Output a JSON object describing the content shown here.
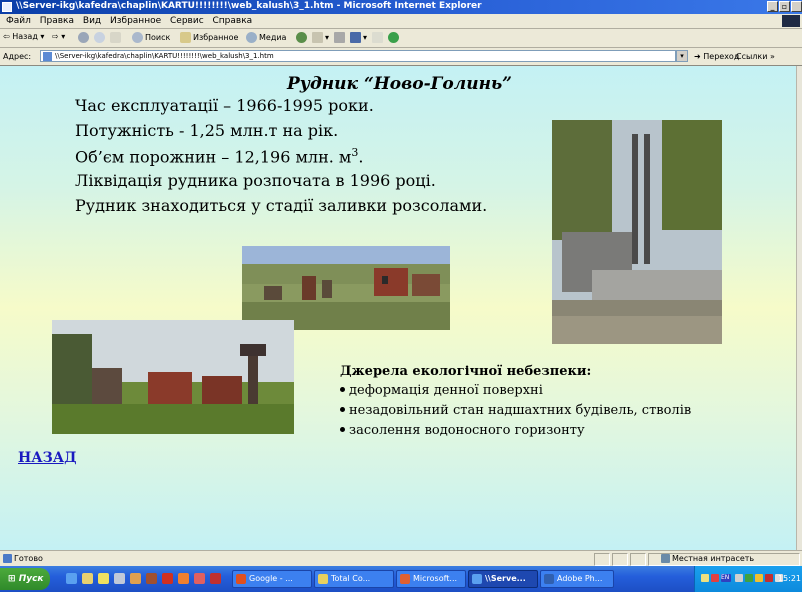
{
  "window": {
    "title": "\\\\Server-ikg\\kafedra\\chaplin\\KARTU!!!!!!!!\\web_kalush\\3_1.htm - Microsoft Internet Explorer",
    "minimize_glyph": "_",
    "maximize_glyph": "▫"
  },
  "menu": [
    "Файл",
    "Правка",
    "Вид",
    "Избранное",
    "Сервис",
    "Справка"
  ],
  "toolbar": {
    "back_label": "Назад",
    "search_label": "Поиск",
    "favorites_label": "Избранное",
    "media_label": "Медиа"
  },
  "address": {
    "label": "Адрес:",
    "url": "\\\\Server-ikg\\kafedra\\chaplin\\KARTU!!!!!!!!\\web_kalush\\3_1.htm",
    "go_label": "Переход",
    "links_label": "Ссылки"
  },
  "slide": {
    "title": "Рудник “Ново-Голинь”",
    "facts": [
      "Час експлуатації – 1966-1995 роки.",
      "Потужність - 1,25 млн.т на рік.",
      "Об’єм порожнин – 12,196 млн. м",
      "Ліквідація рудника розпочата в 1996 році.",
      "Рудник знаходиться у стадії заливки розсолами."
    ],
    "volume_superscript": "3",
    "hazards_title": "Джерела екологічної небезпеки:",
    "hazards": [
      "деформація денної поверхні",
      "незадовільний стан надшахтних будівель, стволів",
      "засолення водоносного горизонту"
    ],
    "back_link": "НАЗАД"
  },
  "status": {
    "text": "Готово",
    "zone": "Местная интрасеть"
  },
  "taskbar": {
    "start_label": "Пуск",
    "tasks": [
      "Google - ...",
      "Total Co...",
      "Microsoft...",
      "\\\\Serve...",
      "Adobe Ph..."
    ],
    "clock": "15:21",
    "lang": "EN"
  },
  "colors": {
    "titlebar": "#0a3ea8",
    "content_top": "#c4f1f4",
    "content_mid": "#f6fbc9",
    "link": "#1a1ac0"
  }
}
